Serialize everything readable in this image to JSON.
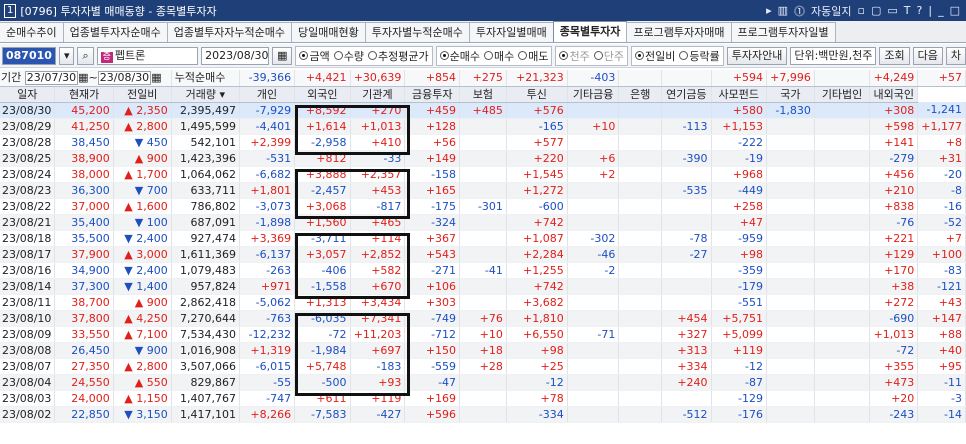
{
  "window": {
    "number": "1",
    "title": "[0796] 투자자별 매매동향 - 종목별투자자",
    "tools": [
      "▸",
      "▥",
      "⓵",
      "자동일지",
      "▫",
      "▢",
      "▭",
      "T",
      "?",
      "|",
      "_",
      "□"
    ]
  },
  "tabs": [
    {
      "label": "순매수추이"
    },
    {
      "label": "업종별투자자순매수"
    },
    {
      "label": "업종별투자자누적순매수"
    },
    {
      "label": "당일매매현황"
    },
    {
      "label": "투자자별누적순매수"
    },
    {
      "label": "투자자일별매매"
    },
    {
      "label": "종목별투자자",
      "active": true
    },
    {
      "label": "프로그램투자자매매"
    },
    {
      "label": "프로그램투자자일별"
    }
  ],
  "toolbar": {
    "code": "087010",
    "name": "펩트론",
    "date": "2023/08/30",
    "radios1": [
      "금액",
      "수량",
      "추정평균가"
    ],
    "radios2": [
      "순매수",
      "매수",
      "매도"
    ],
    "radios3": [
      "천주",
      "단주"
    ],
    "radios4": [
      "전일비",
      "등락률"
    ],
    "investor_btn": "투자자안내",
    "unit": "단위:백만원,천주",
    "btn_search": "조회",
    "btn_next": "다음",
    "btn_chart": "차"
  },
  "period": {
    "label": "기간",
    "from": "23/07/30",
    "to": "23/08/30",
    "metric": "누적순매수"
  },
  "summary": [
    "-39,366",
    "+4,421",
    "+30,639",
    "+854",
    "+275",
    "+21,323",
    "-403",
    "",
    "",
    "+594",
    "+7,996",
    "",
    "+4,249",
    "+57"
  ],
  "columns": [
    "일자",
    "현재가",
    "전일비",
    "거래량",
    "개인",
    "외국인",
    "기관계",
    "금융투자",
    "보험",
    "투신",
    "기타금융",
    "은행",
    "연기금등",
    "사모펀드",
    "국가",
    "기타법인",
    "내외국인"
  ],
  "rows": [
    {
      "d": "23/08/30",
      "p": "45,200",
      "dir": "up",
      "c": "2,350",
      "v": "2,395,497",
      "v1": [
        "-7,929",
        "+8,592",
        "+270",
        "+459",
        "+485",
        "+576",
        "",
        "",
        "",
        "+580",
        "-1,830",
        "",
        "+308",
        "-1,241"
      ]
    },
    {
      "d": "23/08/29",
      "p": "41,250",
      "dir": "up",
      "c": "2,800",
      "v": "1,495,599",
      "v1": [
        "-4,401",
        "+1,614",
        "+1,013",
        "+128",
        "",
        "-165",
        "+10",
        "",
        "-113",
        "+1,153",
        "",
        "",
        "+598",
        "+1,177"
      ]
    },
    {
      "d": "23/08/28",
      "p": "38,450",
      "dir": "down",
      "c": "450",
      "v": "542,101",
      "v1": [
        "+2,399",
        "-2,958",
        "+410",
        "+56",
        "",
        "+577",
        "",
        "",
        "",
        "-222",
        "",
        "",
        "+141",
        "+8"
      ]
    },
    {
      "d": "23/08/25",
      "p": "38,900",
      "dir": "up",
      "c": "900",
      "v": "1,423,396",
      "v1": [
        "-531",
        "+812",
        "-33",
        "+149",
        "",
        "+220",
        "+6",
        "",
        "-390",
        "-19",
        "",
        "",
        "-279",
        "+31"
      ]
    },
    {
      "d": "23/08/24",
      "p": "38,000",
      "dir": "up",
      "c": "1,700",
      "v": "1,064,062",
      "v1": [
        "-6,682",
        "+3,888",
        "+2,357",
        "-158",
        "",
        "+1,545",
        "+2",
        "",
        "",
        "+968",
        "",
        "",
        "+456",
        "-20"
      ]
    },
    {
      "d": "23/08/23",
      "p": "36,300",
      "dir": "down",
      "c": "700",
      "v": "633,711",
      "v1": [
        "+1,801",
        "-2,457",
        "+453",
        "+165",
        "",
        "+1,272",
        "",
        "",
        "-535",
        "-449",
        "",
        "",
        "+210",
        "-8"
      ]
    },
    {
      "d": "23/08/22",
      "p": "37,000",
      "dir": "up",
      "c": "1,600",
      "v": "786,802",
      "v1": [
        "-3,073",
        "+3,068",
        "-817",
        "-175",
        "-301",
        "-600",
        "",
        "",
        "",
        "+258",
        "",
        "",
        "+838",
        "-16"
      ]
    },
    {
      "d": "23/08/21",
      "p": "35,400",
      "dir": "down",
      "c": "100",
      "v": "687,091",
      "v1": [
        "-1,898",
        "+1,560",
        "+465",
        "-324",
        "",
        "+742",
        "",
        "",
        "",
        "+47",
        "",
        "",
        "-76",
        "-52"
      ]
    },
    {
      "d": "23/08/18",
      "p": "35,500",
      "dir": "down",
      "c": "2,400",
      "v": "927,474",
      "v1": [
        "+3,369",
        "-3,711",
        "+114",
        "+367",
        "",
        "+1,087",
        "-302",
        "",
        "-78",
        "-959",
        "",
        "",
        "+221",
        "+7"
      ]
    },
    {
      "d": "23/08/17",
      "p": "37,900",
      "dir": "up",
      "c": "3,000",
      "v": "1,611,369",
      "v1": [
        "-6,137",
        "+3,057",
        "+2,852",
        "+543",
        "",
        "+2,284",
        "-46",
        "",
        "-27",
        "+98",
        "",
        "",
        "+129",
        "+100"
      ]
    },
    {
      "d": "23/08/16",
      "p": "34,900",
      "dir": "down",
      "c": "2,400",
      "v": "1,079,483",
      "v1": [
        "-263",
        "-406",
        "+582",
        "-271",
        "-41",
        "+1,255",
        "-2",
        "",
        "",
        "-359",
        "",
        "",
        "+170",
        "-83"
      ]
    },
    {
      "d": "23/08/14",
      "p": "37,300",
      "dir": "down",
      "c": "1,400",
      "v": "957,824",
      "v1": [
        "+971",
        "-1,558",
        "+670",
        "+106",
        "",
        "+742",
        "",
        "",
        "",
        "-179",
        "",
        "",
        "+38",
        "-121"
      ]
    },
    {
      "d": "23/08/11",
      "p": "38,700",
      "dir": "up",
      "c": "900",
      "v": "2,862,418",
      "v1": [
        "-5,062",
        "+1,313",
        "+3,434",
        "+303",
        "",
        "+3,682",
        "",
        "",
        "",
        "-551",
        "",
        "",
        "+272",
        "+43"
      ]
    },
    {
      "d": "23/08/10",
      "p": "37,800",
      "dir": "up",
      "c": "4,250",
      "v": "7,270,644",
      "v1": [
        "-763",
        "-6,035",
        "+7,341",
        "-749",
        "+76",
        "+1,810",
        "",
        "",
        "+454",
        "+5,751",
        "",
        "",
        "-690",
        "+147"
      ]
    },
    {
      "d": "23/08/09",
      "p": "33,550",
      "dir": "up",
      "c": "7,100",
      "v": "7,534,430",
      "v1": [
        "-12,232",
        "-72",
        "+11,203",
        "-712",
        "+10",
        "+6,550",
        "-71",
        "",
        "+327",
        "+5,099",
        "",
        "",
        "+1,013",
        "+88"
      ]
    },
    {
      "d": "23/08/08",
      "p": "26,450",
      "dir": "down",
      "c": "900",
      "v": "1,016,908",
      "v1": [
        "+1,319",
        "-1,984",
        "+697",
        "+150",
        "+18",
        "+98",
        "",
        "",
        "+313",
        "+119",
        "",
        "",
        "-72",
        "+40"
      ]
    },
    {
      "d": "23/08/07",
      "p": "27,350",
      "dir": "up",
      "c": "2,800",
      "v": "3,507,066",
      "v1": [
        "-6,015",
        "+5,748",
        "-183",
        "-559",
        "+28",
        "+25",
        "",
        "",
        "+334",
        "-12",
        "",
        "",
        "+355",
        "+95"
      ]
    },
    {
      "d": "23/08/04",
      "p": "24,550",
      "dir": "up",
      "c": "550",
      "v": "829,867",
      "v1": [
        "-55",
        "-500",
        "+93",
        "-47",
        "",
        "-12",
        "",
        "",
        "+240",
        "-87",
        "",
        "",
        "+473",
        "-11"
      ]
    },
    {
      "d": "23/08/03",
      "p": "24,000",
      "dir": "up",
      "c": "1,150",
      "v": "1,407,767",
      "v1": [
        "-747",
        "+611",
        "+119",
        "+169",
        "",
        "+78",
        "",
        "",
        "",
        "-129",
        "",
        "",
        "+20",
        "-3"
      ]
    },
    {
      "d": "23/08/02",
      "p": "22,850",
      "dir": "down",
      "c": "3,150",
      "v": "1,417,101",
      "v1": [
        "+8,266",
        "-7,583",
        "-427",
        "+596",
        "",
        "-334",
        "",
        "",
        "-512",
        "-176",
        "",
        "",
        "-243",
        "-14"
      ]
    }
  ],
  "colors": {
    "up": "#e0201b",
    "down": "#1d4fc2",
    "title": "#1f3f78"
  }
}
